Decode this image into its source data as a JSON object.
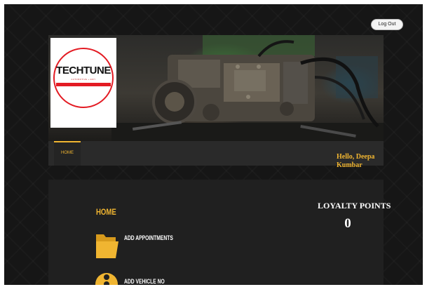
{
  "header": {
    "logout_label": "Log Out"
  },
  "logo": {
    "word": "TECHTUNE",
    "subtitle": "AUTOMOTIVE + ADIY",
    "accent_color": "#e31b23"
  },
  "nav": {
    "tabs": [
      {
        "label": "HOME",
        "active": true
      }
    ],
    "greeting": "Hello, Deepa Kumbar"
  },
  "main": {
    "title": "HOME",
    "menu": [
      {
        "label": "ADD APPOINTMENTS",
        "icon": "folder-icon"
      },
      {
        "label": "ADD VEHICLE NO",
        "icon": "wheel-icon"
      }
    ],
    "loyalty": {
      "title": "LOYALTY POINTS",
      "value": "0"
    }
  },
  "colors": {
    "accent": "#f0b531",
    "background": "#161616",
    "panel": "#202020"
  }
}
